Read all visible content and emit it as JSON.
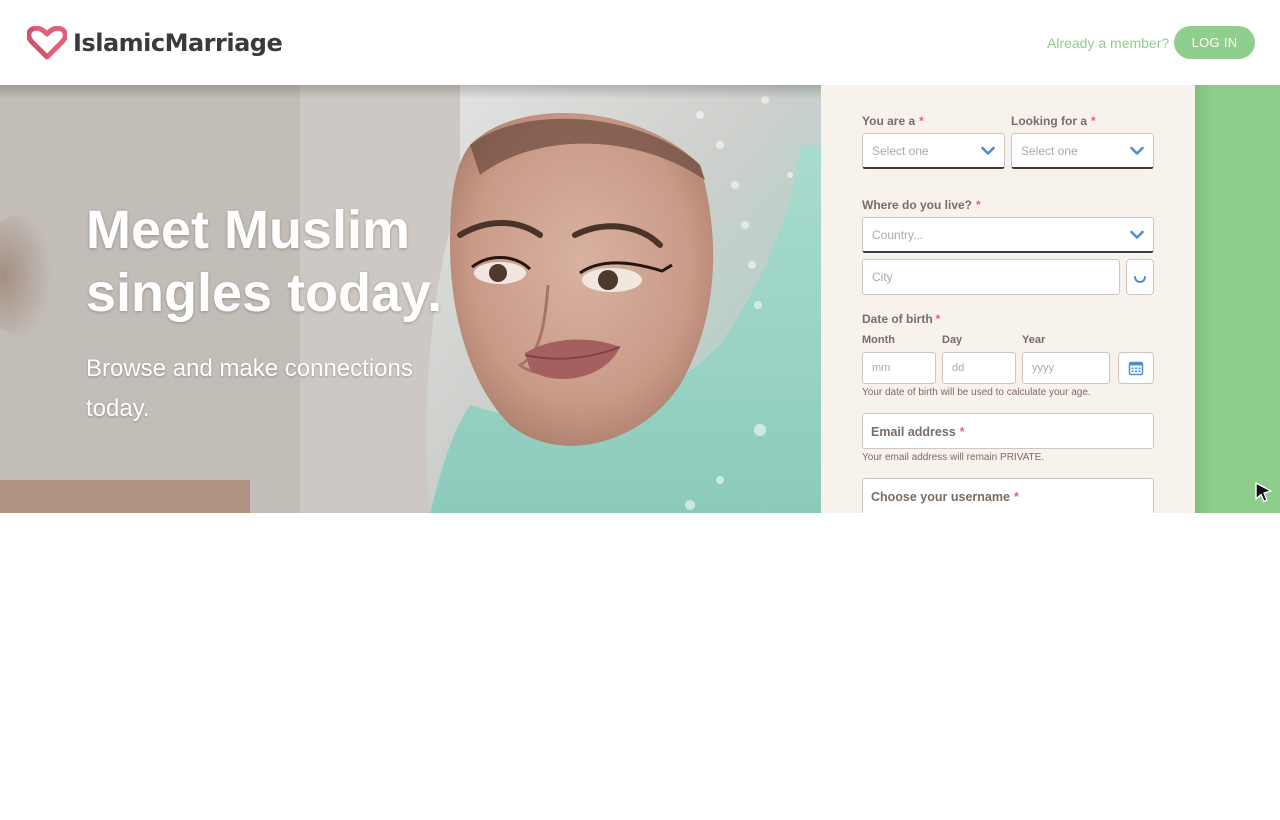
{
  "brand": {
    "name": "IslamicMarriage",
    "logo_icon": "heart-icon",
    "colors": {
      "heart_pink": "#e0607a",
      "accent_green": "#8fce8c",
      "text_dark": "#3a3a3a"
    }
  },
  "header": {
    "already_member": "Already a member?",
    "login_label": "LOG IN"
  },
  "hero": {
    "title": "Meet Muslim singles today.",
    "subtitle": "Browse and make connections today."
  },
  "form": {
    "you_are": {
      "label": "You are a",
      "placeholder": "Select one"
    },
    "looking_for": {
      "label": "Looking for a",
      "placeholder": "Select one"
    },
    "where_live": {
      "label": "Where do you live?",
      "country_placeholder": "Country...",
      "city_placeholder": "City",
      "locate_icon": "spinner-icon"
    },
    "dob": {
      "label": "Date of birth",
      "month_label": "Month",
      "month_placeholder": "mm",
      "day_label": "Day",
      "day_placeholder": "dd",
      "year_label": "Year",
      "year_placeholder": "yyyy",
      "calendar_icon": "calendar-icon",
      "hint": "Your date of birth will be used to calculate your age."
    },
    "email": {
      "label": "Email address",
      "hint": "Your email address will remain PRIVATE."
    },
    "username": {
      "label": "Choose your username"
    },
    "required_mark": "*"
  }
}
